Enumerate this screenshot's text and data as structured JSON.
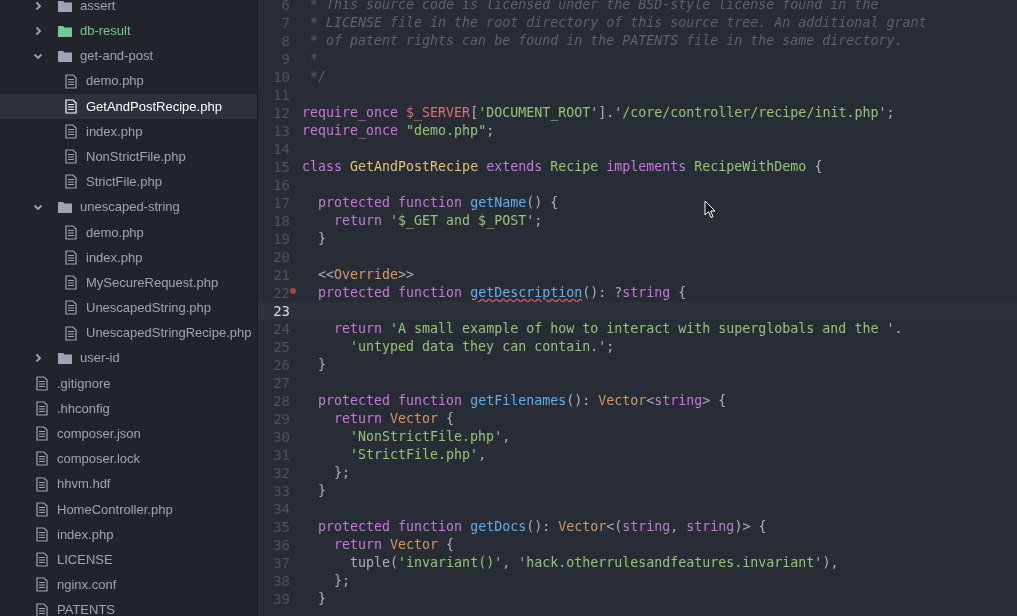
{
  "tree": [
    {
      "kind": "folder",
      "label": "assert",
      "expanded": false,
      "selected": false
    },
    {
      "kind": "folder",
      "label": "db-result",
      "expanded": false,
      "selected": false,
      "color": "#73c990"
    },
    {
      "kind": "folder",
      "label": "get-and-post",
      "expanded": true,
      "selected": false,
      "children": [
        {
          "kind": "file",
          "label": "demo.php",
          "selected": false
        },
        {
          "kind": "file",
          "label": "GetAndPostRecipe.php",
          "selected": true
        },
        {
          "kind": "file",
          "label": "index.php",
          "selected": false
        },
        {
          "kind": "file",
          "label": "NonStrictFile.php",
          "selected": false
        },
        {
          "kind": "file",
          "label": "StrictFile.php",
          "selected": false
        }
      ]
    },
    {
      "kind": "folder",
      "label": "unescaped-string",
      "expanded": true,
      "selected": false,
      "children": [
        {
          "kind": "file",
          "label": "demo.php",
          "selected": false
        },
        {
          "kind": "file",
          "label": "index.php",
          "selected": false
        },
        {
          "kind": "file",
          "label": "MySecureRequest.php",
          "selected": false
        },
        {
          "kind": "file",
          "label": "UnescapedString.php",
          "selected": false
        },
        {
          "kind": "file",
          "label": "UnescapedStringRecipe.php",
          "selected": false
        }
      ]
    },
    {
      "kind": "folder",
      "label": "user-id",
      "expanded": false,
      "selected": false
    },
    {
      "kind": "file",
      "label": ".gitignore",
      "selected": false
    },
    {
      "kind": "file",
      "label": ".hhconfig",
      "selected": false
    },
    {
      "kind": "file",
      "label": "composer.json",
      "selected": false
    },
    {
      "kind": "file",
      "label": "composer.lock",
      "selected": false
    },
    {
      "kind": "file",
      "label": "hhvm.hdf",
      "selected": false
    },
    {
      "kind": "file",
      "label": "HomeController.php",
      "selected": false
    },
    {
      "kind": "file",
      "label": "index.php",
      "selected": false
    },
    {
      "kind": "file",
      "label": "LICENSE",
      "selected": false
    },
    {
      "kind": "file",
      "label": "nginx.conf",
      "selected": false
    },
    {
      "kind": "file",
      "label": "PATENTS",
      "selected": false
    }
  ],
  "editor": {
    "lines": [
      {
        "number": "6",
        "current": false,
        "marked": false,
        "tokens": [
          {
            "kind": "comment",
            "text": " * This source code is licensed under the BSD-style license found in the"
          }
        ]
      },
      {
        "number": "7",
        "current": false,
        "marked": false,
        "tokens": [
          {
            "kind": "comment",
            "text": " * LICENSE file in the root directory of this source tree. An additional grant"
          }
        ]
      },
      {
        "number": "8",
        "current": false,
        "marked": false,
        "tokens": [
          {
            "kind": "comment",
            "text": " * of patent rights can be found in the PATENTS file in the same directory."
          }
        ]
      },
      {
        "number": "9",
        "current": false,
        "marked": false,
        "tokens": [
          {
            "kind": "comment",
            "text": " *"
          }
        ]
      },
      {
        "number": "10",
        "current": false,
        "marked": false,
        "tokens": [
          {
            "kind": "comment",
            "text": " */"
          }
        ]
      },
      {
        "number": "11",
        "current": false,
        "marked": false
      },
      {
        "number": "12",
        "current": false,
        "marked": false,
        "tokens": [
          {
            "kind": "keyword",
            "text": "require_once "
          },
          {
            "kind": "variable",
            "text": "$_SERVER"
          },
          {
            "kind": "plain",
            "text": "["
          },
          {
            "kind": "string",
            "text": "'DOCUMENT_ROOT'"
          },
          {
            "kind": "plain",
            "text": "]."
          },
          {
            "kind": "string",
            "text": "'/core/controller/recipe/init.php'"
          },
          {
            "kind": "plain",
            "text": ";"
          }
        ]
      },
      {
        "number": "13",
        "current": false,
        "marked": false,
        "tokens": [
          {
            "kind": "keyword",
            "text": "require_once "
          },
          {
            "kind": "string",
            "text": "\"demo.php\""
          },
          {
            "kind": "plain",
            "text": ";"
          }
        ]
      },
      {
        "number": "14",
        "current": false,
        "marked": false
      },
      {
        "number": "15",
        "current": false,
        "marked": false,
        "tokens": [
          {
            "kind": "keyword",
            "text": "class "
          },
          {
            "kind": "class",
            "text": "GetAndPostRecipe "
          },
          {
            "kind": "keyword",
            "text": "extends "
          },
          {
            "kind": "parent",
            "text": "Recipe "
          },
          {
            "kind": "keyword",
            "text": "implements "
          },
          {
            "kind": "parent",
            "text": "RecipeWithDemo"
          },
          {
            "kind": "plain",
            "text": " {"
          }
        ]
      },
      {
        "number": "16",
        "current": false,
        "marked": false
      },
      {
        "number": "17",
        "current": false,
        "marked": false,
        "tokens": [
          {
            "kind": "keyword",
            "text": "  protected function "
          },
          {
            "kind": "function",
            "text": "getName"
          },
          {
            "kind": "plain",
            "text": "() {"
          }
        ]
      },
      {
        "number": "18",
        "current": false,
        "marked": false,
        "tokens": [
          {
            "kind": "keyword",
            "text": "    return "
          },
          {
            "kind": "string",
            "text": "'$_GET and $_POST'"
          },
          {
            "kind": "plain",
            "text": ";"
          }
        ]
      },
      {
        "number": "19",
        "current": false,
        "marked": false,
        "tokens": [
          {
            "kind": "plain",
            "text": "  }"
          }
        ]
      },
      {
        "number": "20",
        "current": false,
        "marked": false
      },
      {
        "number": "21",
        "current": false,
        "marked": false,
        "tokens": [
          {
            "kind": "plain",
            "text": "  <<"
          },
          {
            "kind": "type",
            "text": "Override"
          },
          {
            "kind": "plain",
            "text": ">>"
          }
        ]
      },
      {
        "number": "22",
        "current": false,
        "marked": true,
        "tokens": [
          {
            "kind": "keyword",
            "text": "  protected function "
          },
          {
            "kind": "function",
            "text": "getDescription",
            "error": true
          },
          {
            "kind": "plain",
            "text": "(): ?"
          },
          {
            "kind": "keyword",
            "text": "string"
          },
          {
            "kind": "plain",
            "text": " {"
          }
        ]
      },
      {
        "number": "23",
        "current": true,
        "marked": false
      },
      {
        "number": "24",
        "current": false,
        "marked": false,
        "tokens": [
          {
            "kind": "keyword",
            "text": "    return "
          },
          {
            "kind": "string",
            "text": "'A small example of how to interact with superglobals and the '"
          },
          {
            "kind": "plain",
            "text": "."
          }
        ]
      },
      {
        "number": "25",
        "current": false,
        "marked": false,
        "tokens": [
          {
            "kind": "string",
            "text": "      'untyped data they can contain.'"
          },
          {
            "kind": "plain",
            "text": ";"
          }
        ]
      },
      {
        "number": "26",
        "current": false,
        "marked": false,
        "tokens": [
          {
            "kind": "plain",
            "text": "  }"
          }
        ]
      },
      {
        "number": "27",
        "current": false,
        "marked": false
      },
      {
        "number": "28",
        "current": false,
        "marked": false,
        "tokens": [
          {
            "kind": "keyword",
            "text": "  protected function "
          },
          {
            "kind": "function",
            "text": "getFilenames"
          },
          {
            "kind": "plain",
            "text": "(): "
          },
          {
            "kind": "type",
            "text": "Vector"
          },
          {
            "kind": "plain",
            "text": "<"
          },
          {
            "kind": "keyword",
            "text": "string"
          },
          {
            "kind": "plain",
            "text": "> {"
          }
        ]
      },
      {
        "number": "29",
        "current": false,
        "marked": false,
        "tokens": [
          {
            "kind": "keyword",
            "text": "    return "
          },
          {
            "kind": "type",
            "text": "Vector"
          },
          {
            "kind": "plain",
            "text": " {"
          }
        ]
      },
      {
        "number": "30",
        "current": false,
        "marked": false,
        "tokens": [
          {
            "kind": "string",
            "text": "      'NonStrictFile.php'"
          },
          {
            "kind": "plain",
            "text": ","
          }
        ]
      },
      {
        "number": "31",
        "current": false,
        "marked": false,
        "tokens": [
          {
            "kind": "string",
            "text": "      'StrictFile.php'"
          },
          {
            "kind": "plain",
            "text": ","
          }
        ]
      },
      {
        "number": "32",
        "current": false,
        "marked": false,
        "tokens": [
          {
            "kind": "plain",
            "text": "    };"
          }
        ]
      },
      {
        "number": "33",
        "current": false,
        "marked": false,
        "tokens": [
          {
            "kind": "plain",
            "text": "  }"
          }
        ]
      },
      {
        "number": "34",
        "current": false,
        "marked": false
      },
      {
        "number": "35",
        "current": false,
        "marked": false,
        "tokens": [
          {
            "kind": "keyword",
            "text": "  protected function "
          },
          {
            "kind": "function",
            "text": "getDocs"
          },
          {
            "kind": "plain",
            "text": "(): "
          },
          {
            "kind": "type",
            "text": "Vector"
          },
          {
            "kind": "plain",
            "text": "<("
          },
          {
            "kind": "keyword",
            "text": "string"
          },
          {
            "kind": "plain",
            "text": ", "
          },
          {
            "kind": "keyword",
            "text": "string"
          },
          {
            "kind": "plain",
            "text": ")> {"
          }
        ]
      },
      {
        "number": "36",
        "current": false,
        "marked": false,
        "tokens": [
          {
            "kind": "keyword",
            "text": "    return "
          },
          {
            "kind": "type",
            "text": "Vector"
          },
          {
            "kind": "plain",
            "text": " {"
          }
        ]
      },
      {
        "number": "37",
        "current": false,
        "marked": false,
        "tokens": [
          {
            "kind": "plain",
            "text": "      tuple("
          },
          {
            "kind": "string",
            "text": "'invariant()'"
          },
          {
            "kind": "plain",
            "text": ", "
          },
          {
            "kind": "string",
            "text": "'hack.otherrulesandfeatures.invariant'"
          },
          {
            "kind": "plain",
            "text": "),"
          }
        ]
      },
      {
        "number": "38",
        "current": false,
        "marked": false,
        "tokens": [
          {
            "kind": "plain",
            "text": "    };"
          }
        ]
      },
      {
        "number": "39",
        "current": false,
        "marked": false,
        "tokens": [
          {
            "kind": "plain",
            "text": "  }"
          }
        ]
      }
    ]
  }
}
